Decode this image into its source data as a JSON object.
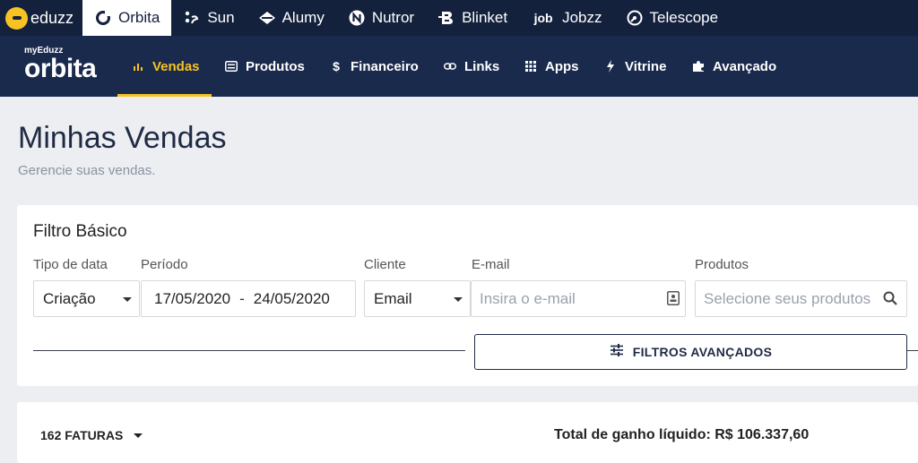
{
  "topbar": {
    "brand": "eduzz",
    "items": [
      {
        "label": "Orbita",
        "icon": "orbita-icon",
        "active": true
      },
      {
        "label": "Sun",
        "icon": "sun-icon"
      },
      {
        "label": "Alumy",
        "icon": "alumy-icon"
      },
      {
        "label": "Nutror",
        "icon": "nutror-icon"
      },
      {
        "label": "Blinket",
        "icon": "blinket-icon"
      },
      {
        "label": "Jobzz",
        "icon": "jobzz-icon"
      },
      {
        "label": "Telescope",
        "icon": "telescope-icon"
      }
    ]
  },
  "navbar": {
    "logo_small": "myEduzz",
    "logo_big": "orbita",
    "items": [
      {
        "label": "Vendas",
        "icon": "bar-chart-icon",
        "active": true
      },
      {
        "label": "Produtos",
        "icon": "list-icon"
      },
      {
        "label": "Financeiro",
        "icon": "dollar-icon"
      },
      {
        "label": "Links",
        "icon": "link-icon"
      },
      {
        "label": "Apps",
        "icon": "grid-icon"
      },
      {
        "label": "Vitrine",
        "icon": "bolt-icon"
      },
      {
        "label": "Avançado",
        "icon": "puzzle-icon"
      }
    ],
    "accent": "#f7c322"
  },
  "page": {
    "title": "Minhas Vendas",
    "subtitle": "Gerencie suas vendas."
  },
  "filter": {
    "title": "Filtro Básico",
    "date_type_label": "Tipo de data",
    "date_type_value": "Criação",
    "period_label": "Período",
    "period_start": "17/05/2020",
    "period_sep": "-",
    "period_end": "24/05/2020",
    "client_label": "Cliente",
    "client_value": "Email",
    "email_label": "E-mail",
    "email_placeholder": "Insira o e-mail",
    "products_label": "Produtos",
    "products_placeholder": "Selecione seus produtos",
    "advanced_button": "FILTROS AVANÇADOS"
  },
  "summary": {
    "invoices": "162 FATURAS",
    "total": "Total de ganho líquido: R$ 106.337,60"
  },
  "colors": {
    "topbar_bg": "#14213d",
    "navbar_bg": "#1a2a4d",
    "accent": "#f7c322"
  }
}
